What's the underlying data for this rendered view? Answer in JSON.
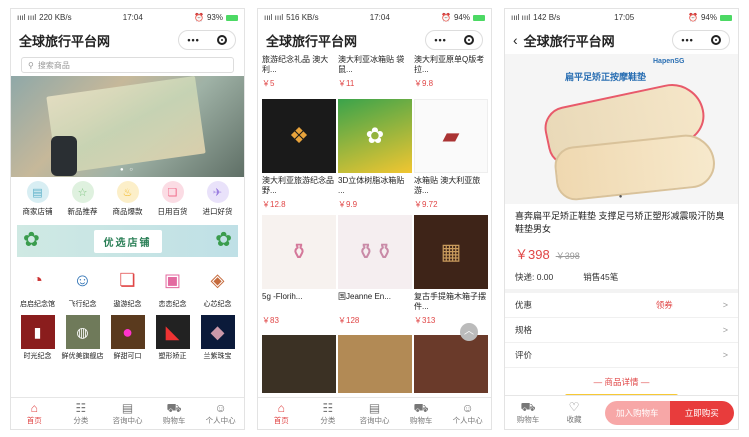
{
  "phone1": {
    "status": {
      "signal": "ıııl ıııl",
      "speed": "220 KB/s",
      "time": "17:04",
      "battery": "93%"
    },
    "title": "全球旅行平台网",
    "search_placeholder": "搜索商品",
    "categories": [
      {
        "label": "商家店铺",
        "icon": "store-icon",
        "color": "#5bb0c9"
      },
      {
        "label": "新品推荐",
        "icon": "star-icon",
        "color": "#7ac27d"
      },
      {
        "label": "商品爆款",
        "icon": "fire-icon",
        "color": "#f2b824"
      },
      {
        "label": "日用百货",
        "icon": "gift-icon",
        "color": "#f06b8a"
      },
      {
        "label": "进口好货",
        "icon": "plane-icon",
        "color": "#9b7ee0"
      }
    ],
    "shop_banner": "优选店铺",
    "shops": [
      {
        "label": "启启纪念馆",
        "icon": "fan-icon"
      },
      {
        "label": "飞行纪念",
        "icon": "people-icon"
      },
      {
        "label": "遨游纪念",
        "icon": "gift-icon"
      },
      {
        "label": "恋恋纪念",
        "icon": "bag-icon"
      },
      {
        "label": "心芯纪念",
        "icon": "cake-icon"
      },
      {
        "label": "时光纪念",
        "icon": "seal-icon"
      },
      {
        "label": "鲜优美旗舰店",
        "icon": "food-icon"
      },
      {
        "label": "鲜甜可口",
        "icon": "fruit-icon"
      },
      {
        "label": "塑形矫正",
        "icon": "shoe-icon"
      },
      {
        "label": "兰紫珠宝",
        "icon": "jewel-icon"
      }
    ],
    "tabs": [
      "首页",
      "分类",
      "咨询中心",
      "购物车",
      "个人中心"
    ]
  },
  "phone2": {
    "status": {
      "signal": "ıııl ıııl",
      "speed": "516 KB/s",
      "time": "17:04",
      "battery": "94%"
    },
    "title": "全球旅行平台网",
    "products": [
      {
        "title": "旅游纪念礼品 澳大利...",
        "price": "￥5"
      },
      {
        "title": "澳大利亚冰箱贴 袋鼠...",
        "price": "￥11"
      },
      {
        "title": "澳大利亚原单Q版考拉...",
        "price": "￥9.8"
      },
      {
        "title": "澳大利亚旅游纪念品野...",
        "price": "￥12.8"
      },
      {
        "title": "3D立体树脂冰箱贴 ...",
        "price": "￥9.9"
      },
      {
        "title": "冰箱贴 澳大利亚旅游...",
        "price": "￥9.72"
      },
      {
        "title": "5g -Florih...",
        "price": "￥83"
      },
      {
        "title": "国Jeanne En...",
        "price": "￥128"
      },
      {
        "title": "复古手提箱木箱子摆件...",
        "price": "￥313"
      }
    ],
    "tabs": [
      "首页",
      "分类",
      "咨询中心",
      "购物车",
      "个人中心"
    ]
  },
  "phone3": {
    "status": {
      "signal": "ıııl ıııl",
      "speed": "142 B/s",
      "time": "17:05",
      "battery": "94%"
    },
    "title": "全球旅行平台网",
    "brand": "HapenSG",
    "img_caption": "扁平足矫正按摩鞋垫",
    "product_title": "喜奔扁平足矫正鞋垫 支撑足弓矫正塑形减震吸汗防臭鞋垫男女",
    "price": "￥398",
    "old_price": "￥398",
    "shipping": "快递: 0.00",
    "sales": "销售45笔",
    "discount_label": "优惠",
    "coupon": "领券",
    "spec_label": "规格",
    "review_label": "评价",
    "details_header": "— 商品详情 —",
    "bottom": {
      "cart": "购物车",
      "fav": "收藏",
      "add_cart": "加入购物车",
      "buy": "立即购买"
    }
  }
}
